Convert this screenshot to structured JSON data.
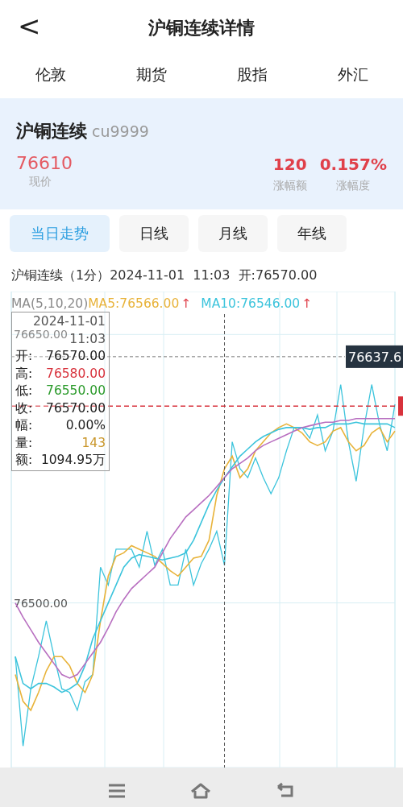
{
  "header": {
    "back": "<",
    "title": "沪铜连续详情"
  },
  "market_tabs": [
    {
      "label": "伦敦"
    },
    {
      "label": "期货"
    },
    {
      "label": "股指"
    },
    {
      "label": "外汇"
    }
  ],
  "quote": {
    "name": "沪铜连续",
    "code": "cu9999",
    "price": "76610",
    "price_label": "现价",
    "stats": [
      {
        "value": "120",
        "label": "涨幅额"
      },
      {
        "value": "0.157%",
        "label": "涨幅度"
      }
    ]
  },
  "period_tabs": [
    {
      "label": "当日走势",
      "selected": true
    },
    {
      "label": "日线",
      "selected": false
    },
    {
      "label": "月线",
      "selected": false
    },
    {
      "label": "年线",
      "selected": false
    }
  ],
  "info_line": "沪铜连续（1分）2024-11-01  11:03  开:76570.00",
  "chart": {
    "legend": [
      {
        "text": "MA(5,10,20)"
      },
      {
        "text": ":76566.00",
        "arrow": "↑"
      },
      {
        "text": ":76546.00",
        "arrow": "↑"
      }
    ],
    "tooltip": {
      "date": "2024-11-01",
      "time": "11:03",
      "rows": [
        {
          "label": "开:",
          "value": "76570.00",
          "color": "#222222"
        },
        {
          "label": "高:",
          "value": "76580.00",
          "color": "#d8323c"
        },
        {
          "label": "低:",
          "value": "76550.00",
          "color": "#2a9a2a"
        },
        {
          "label": "收:",
          "value": "76570.00",
          "color": "#222222"
        },
        {
          "label": "幅:",
          "value": "0.00%",
          "color": "#222222"
        },
        {
          "label": "量:",
          "value": "143",
          "color": "#c9962a"
        },
        {
          "label": "额:",
          "value": "1094.95万",
          "color": "#222222"
        }
      ]
    },
    "chart_data": {
      "type": "line",
      "grid": true,
      "ylim": [
        76408,
        76674
      ],
      "yticks": [
        {
          "value": 76650,
          "label": "76650.00"
        },
        {
          "value": 76500,
          "label": "76500.00"
        }
      ],
      "ref_lines": [
        {
          "axis": "y",
          "value": 76637.6,
          "label": "76637.6",
          "color": "#777777"
        },
        {
          "axis": "y",
          "value": 76610,
          "color": "#d8323c"
        }
      ],
      "series": [
        {
          "color": "#3cc4dc",
          "values": [
            76470,
            76420,
            76452,
            76470,
            76490,
            76470,
            76452,
            76450,
            76440,
            76456,
            76460,
            76520,
            76510,
            76530,
            76530,
            76530,
            76520,
            76540,
            76521,
            76530,
            76510,
            76510,
            76530,
            76510,
            76522,
            76530,
            76540,
            76521,
            76590,
            76575,
            76570,
            76581,
            76570,
            76561,
            76570,
            76585,
            76598,
            76598,
            76592,
            76605,
            76585,
            76596,
            76622,
            76590,
            76568,
            76598,
            76622,
            76600,
            76585,
            76611
          ]
        },
        {
          "name": "MA5",
          "color": "#e8b33a",
          "values": [
            76460,
            76445,
            76440,
            76450,
            76462,
            76470,
            76470,
            76465,
            76455,
            76450,
            76460,
            76490,
            76515,
            76526,
            76528,
            76532,
            76530,
            76528,
            76526,
            76522,
            76518,
            76515,
            76520,
            76525,
            76526,
            76535,
            76560,
            76575,
            76582,
            76570,
            76575,
            76585,
            76590,
            76595,
            76598,
            76600,
            76598,
            76595,
            76590,
            76588,
            76590,
            76596,
            76598,
            76590,
            76585,
            76588,
            76595,
            76598,
            76590,
            76596
          ]
        },
        {
          "name": "MA10",
          "color": "#3cc4dc",
          "values": [
            76470,
            76455,
            76452,
            76455,
            76455,
            76453,
            76450,
            76452,
            76455,
            76465,
            76480,
            76490,
            76500,
            76510,
            76520,
            76525,
            76527,
            76526,
            76525,
            76524,
            76525,
            76526,
            76528,
            76535,
            76545,
            76555,
            76563,
            76570,
            76576,
            76582,
            76586,
            76590,
            76593,
            76595,
            76597,
            76598,
            76598,
            76598,
            76597,
            76598,
            76598,
            76600,
            76600,
            76600,
            76601,
            76600,
            76600,
            76600,
            76600,
            76598
          ]
        },
        {
          "color": "#b86fc0",
          "values": [
            76500,
            76492,
            76485,
            76478,
            76472,
            76466,
            76460,
            76458,
            76460,
            76466,
            76472,
            76478,
            76486,
            76495,
            76502,
            76508,
            76512,
            76516,
            76520,
            76528,
            76536,
            76542,
            76548,
            76552,
            76556,
            76560,
            76565,
            76570,
            76575,
            76578,
            76581,
            76585,
            76588,
            76590,
            76592,
            76594,
            76596,
            76598,
            76599,
            76600,
            76601,
            76601,
            76602,
            76602,
            76603,
            76603,
            76603,
            76603,
            76603,
            76603
          ]
        }
      ]
    }
  },
  "nav_bar": [
    {
      "kind": "menu"
    },
    {
      "kind": "home"
    },
    {
      "kind": "back"
    }
  ]
}
